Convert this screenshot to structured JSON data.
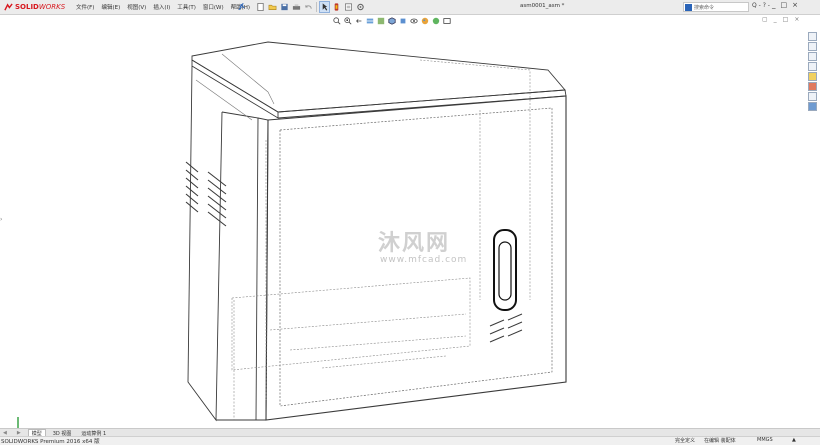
{
  "app": {
    "logo_ds": "3S",
    "logo_solid": "SOLID",
    "logo_works": "WORKS",
    "doc_title": "asm0001_asm *",
    "accent": "#d71920"
  },
  "menu": {
    "items": [
      "文件(F)",
      "编辑(E)",
      "视图(V)",
      "插入(I)",
      "工具(T)",
      "窗口(W)",
      "帮助(H)"
    ]
  },
  "search": {
    "placeholder": "搜索命令",
    "button": "Q -"
  },
  "help_button": "? -",
  "window_controls": [
    "_",
    "□",
    "×"
  ],
  "watermark": {
    "cn": "沐风网",
    "url": "www.mfcad.com"
  },
  "tabs": {
    "nav_prev": "◀",
    "nav_next": "▶",
    "items": [
      {
        "label": "模型",
        "active": true
      },
      {
        "label": "3D 视图",
        "active": false
      },
      {
        "label": "运动算例 1",
        "active": false
      }
    ]
  },
  "status": {
    "product": "SOLIDWORKS Premium 2016 x64 版",
    "fully_defined": "完全定义",
    "editing": "在编辑 装配体",
    "units": "MMGS",
    "units_arrow": "▲"
  },
  "icons": {
    "pin": "pin-icon",
    "new": "new-document-icon",
    "open": "open-folder-icon",
    "save": "save-icon",
    "print": "print-icon",
    "undo": "undo-icon",
    "select": "select-arrow-icon",
    "rebuild": "rebuild-icon",
    "file_props": "file-properties-icon",
    "options": "options-gear-icon"
  }
}
